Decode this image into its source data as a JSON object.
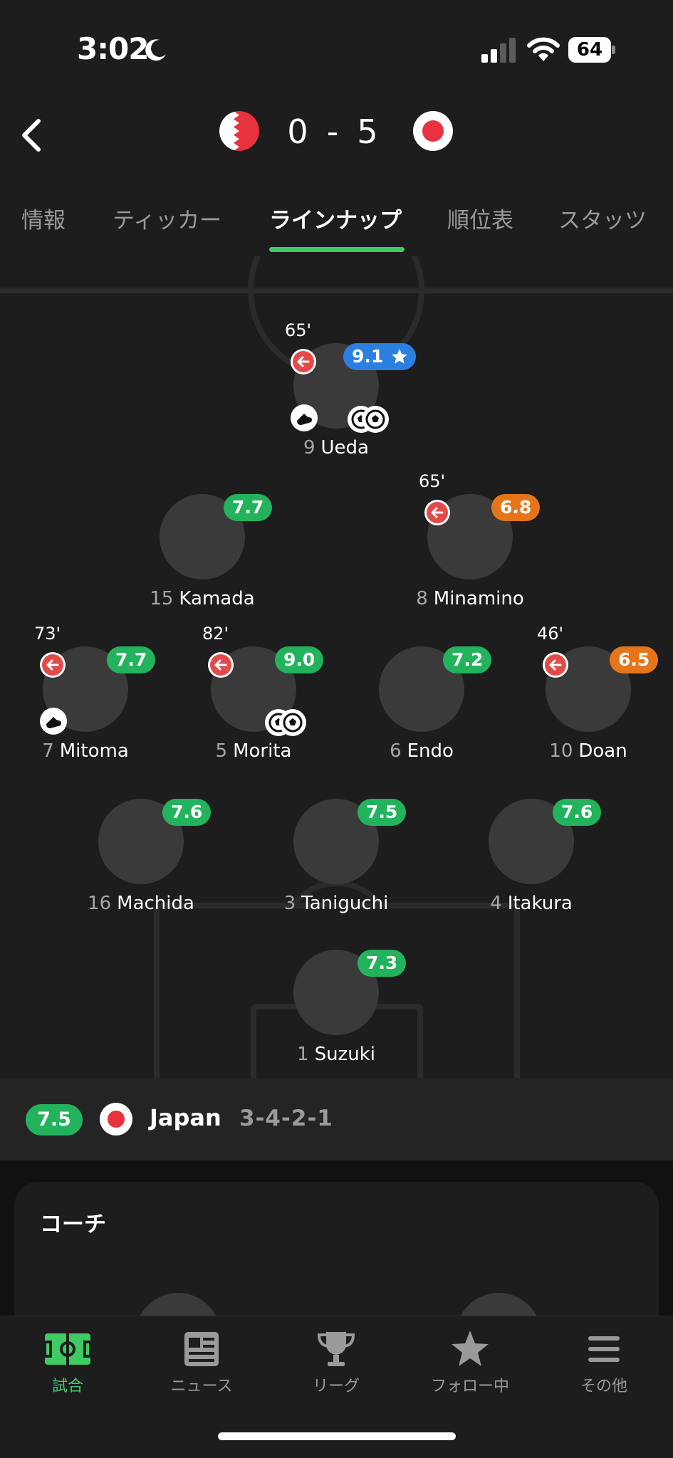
{
  "status_bar": {
    "time": "3:02",
    "battery": "64"
  },
  "match": {
    "home_score": "0",
    "separator": "-",
    "away_score": "5"
  },
  "tabs": [
    {
      "label": "情報"
    },
    {
      "label": "ティッカー"
    },
    {
      "label": "ラインナップ"
    },
    {
      "label": "順位表"
    },
    {
      "label": "スタッツ"
    }
  ],
  "active_tab": "ラインナップ",
  "players": {
    "ueda": {
      "number": "9",
      "name": "Ueda",
      "rating": "9.1",
      "rating_color": "#2b7fe0",
      "sub_minute": "65'",
      "player_of_match": true,
      "assists": 1,
      "goals": 2
    },
    "kamada": {
      "number": "15",
      "name": "Kamada",
      "rating": "7.7",
      "rating_color": "#22b35c"
    },
    "minamino": {
      "number": "8",
      "name": "Minamino",
      "rating": "6.8",
      "rating_color": "#e6751a",
      "sub_minute": "65'"
    },
    "mitoma": {
      "number": "7",
      "name": "Mitoma",
      "rating": "7.7",
      "rating_color": "#22b35c",
      "sub_minute": "73'",
      "assists": 1
    },
    "morita": {
      "number": "5",
      "name": "Morita",
      "rating": "9.0",
      "rating_color": "#22b35c",
      "sub_minute": "82'",
      "goals": 2
    },
    "endo": {
      "number": "6",
      "name": "Endo",
      "rating": "7.2",
      "rating_color": "#22b35c"
    },
    "doan": {
      "number": "10",
      "name": "Doan",
      "rating": "6.5",
      "rating_color": "#e6751a",
      "sub_minute": "46'"
    },
    "machida": {
      "number": "16",
      "name": "Machida",
      "rating": "7.6",
      "rating_color": "#22b35c"
    },
    "taniguchi": {
      "number": "3",
      "name": "Taniguchi",
      "rating": "7.5",
      "rating_color": "#22b35c"
    },
    "itakura": {
      "number": "4",
      "name": "Itakura",
      "rating": "7.6",
      "rating_color": "#22b35c"
    },
    "suzuki": {
      "number": "1",
      "name": "Suzuki",
      "rating": "7.3",
      "rating_color": "#22b35c"
    }
  },
  "team": {
    "rating": "7.5",
    "name": "Japan",
    "formation": "3-4-2-1"
  },
  "coach": {
    "title": "コーチ"
  },
  "nav": [
    {
      "label": "試合",
      "icon": "pitch-icon",
      "active": true
    },
    {
      "label": "ニュース",
      "icon": "news-icon"
    },
    {
      "label": "リーグ",
      "icon": "trophy-icon"
    },
    {
      "label": "フォロー中",
      "icon": "star-icon"
    },
    {
      "label": "その他",
      "icon": "menu-icon"
    }
  ],
  "colors": {
    "accent": "#3fcb63",
    "rating_green": "#22b35c",
    "rating_orange": "#e6751a",
    "rating_blue": "#2b7fe0",
    "sub_red": "#e34b4b"
  }
}
